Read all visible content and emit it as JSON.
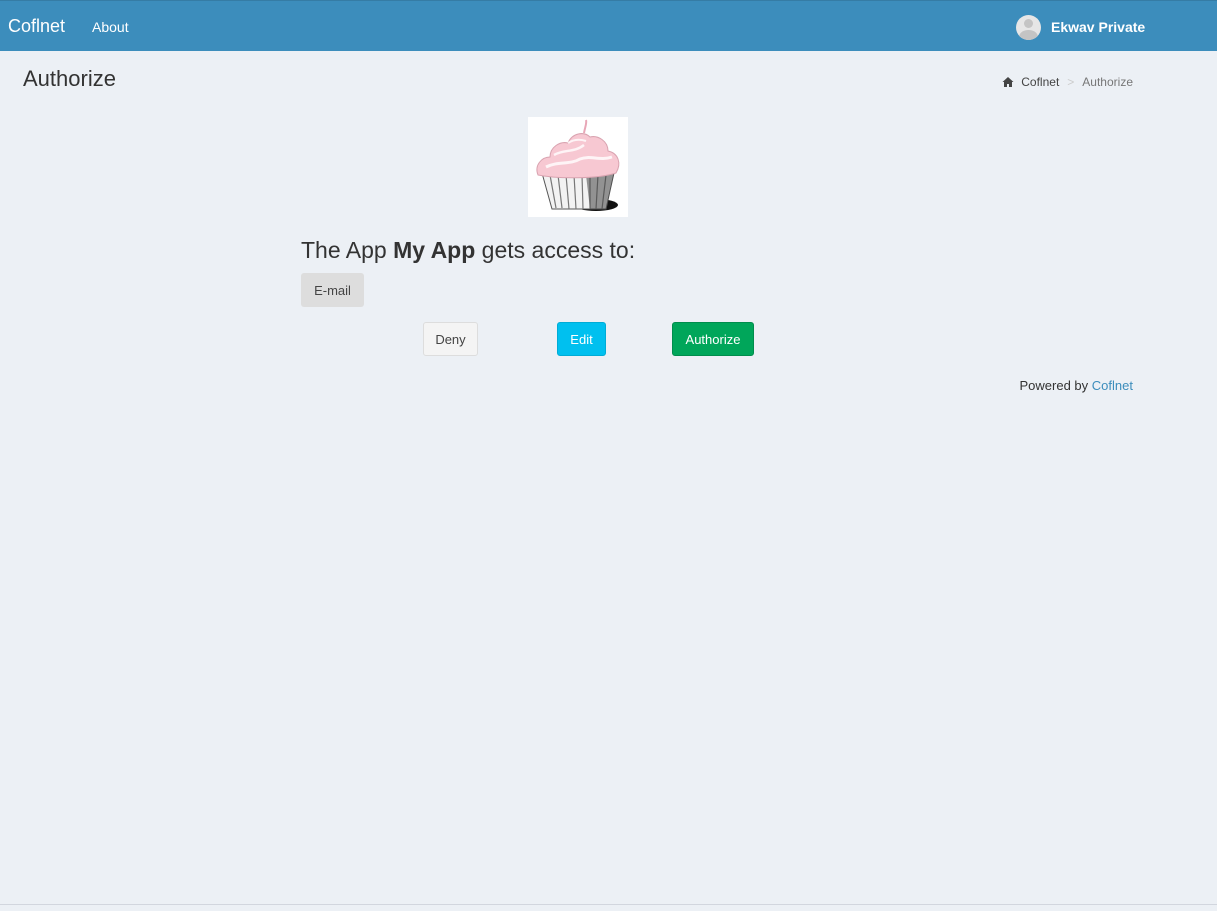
{
  "navbar": {
    "brand": "Coflnet",
    "links": [
      {
        "label": "About"
      }
    ],
    "user": {
      "name": "Ekwav Private",
      "avatar_icon": "user-avatar-icon"
    }
  },
  "header": {
    "title": "Authorize",
    "breadcrumb": [
      {
        "label": "Coflnet",
        "icon": "home-icon"
      },
      {
        "label": "Authorize"
      }
    ],
    "breadcrumb_separator": ">"
  },
  "main": {
    "app_logo": "cupcake-image",
    "access_prefix": "The App",
    "app_name": "My App",
    "access_suffix": "gets access to:",
    "scopes": [
      "E-mail"
    ],
    "buttons": {
      "deny": "Deny",
      "edit": "Edit",
      "authorize": "Authorize"
    }
  },
  "footer": {
    "powered_by": "Powered by",
    "powered_link": "Coflnet"
  },
  "colors": {
    "navbar": "#3c8dbc",
    "background": "#ecf0f5",
    "edit_button": "#00c0ef",
    "authorize_button": "#00a65a",
    "link": "#3c8dbc"
  }
}
